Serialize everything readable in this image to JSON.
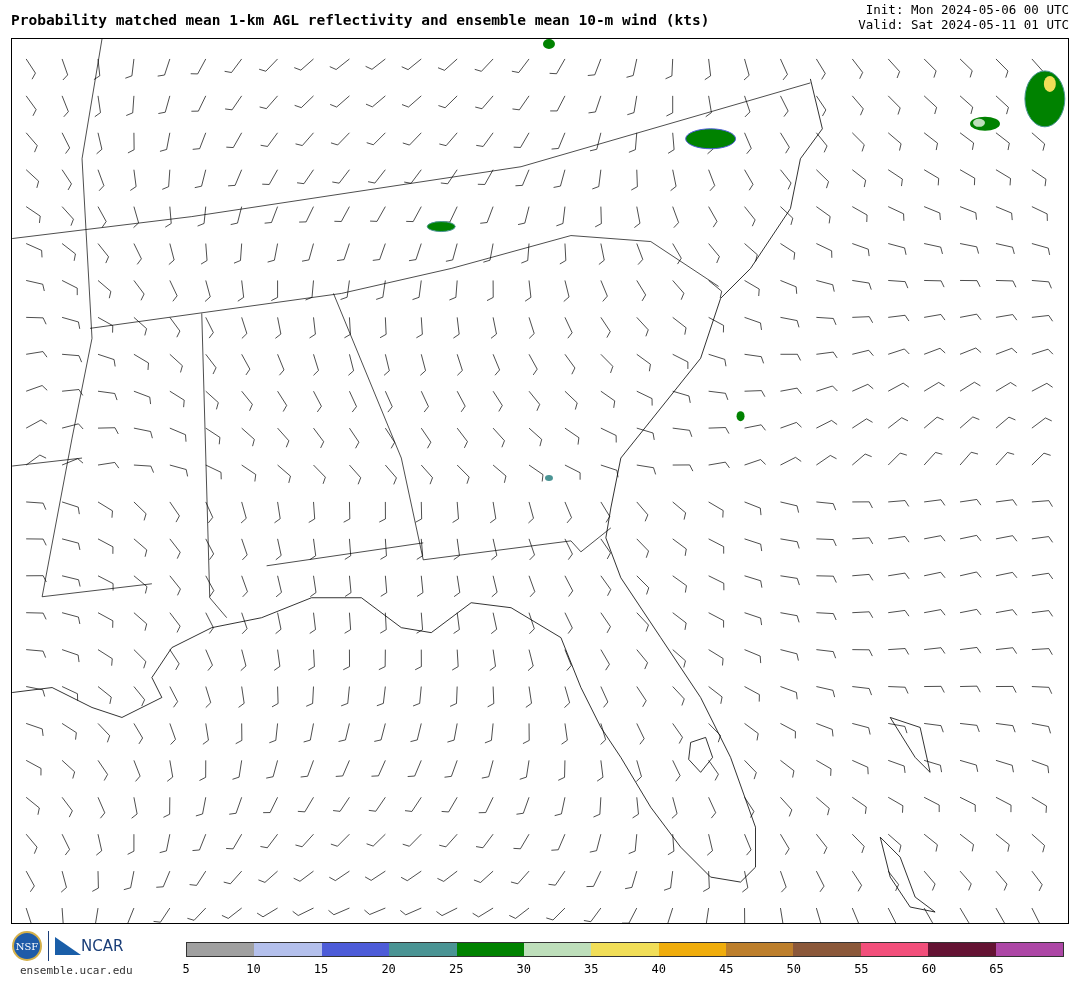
{
  "title": "Probability matched mean 1-km AGL reflectivity and ensemble mean 10-m wind (kts)",
  "init": "Init: Mon 2024-05-06 00 UTC",
  "valid": "Valid: Sat 2024-05-11 01 UTC",
  "logos": {
    "nsf": "NSF",
    "ncar": "NCAR"
  },
  "site": "ensemble.ucar.edu",
  "colorbar": {
    "bins": [
      {
        "color": "#a0a0a0"
      },
      {
        "color": "#b4c0ec"
      },
      {
        "color": "#4d5cd8"
      },
      {
        "color": "#4a9494"
      },
      {
        "color": "#008200"
      },
      {
        "color": "#bedfbb"
      },
      {
        "color": "#f1de58"
      },
      {
        "color": "#f0ad0c"
      },
      {
        "color": "#bd7f2c"
      },
      {
        "color": "#8b583a"
      },
      {
        "color": "#f24f7b"
      },
      {
        "color": "#641333"
      },
      {
        "color": "#ad47a6"
      }
    ],
    "ticks": [
      "5",
      "10",
      "15",
      "20",
      "25",
      "30",
      "35",
      "40",
      "45",
      "50",
      "55",
      "60",
      "65"
    ]
  }
}
